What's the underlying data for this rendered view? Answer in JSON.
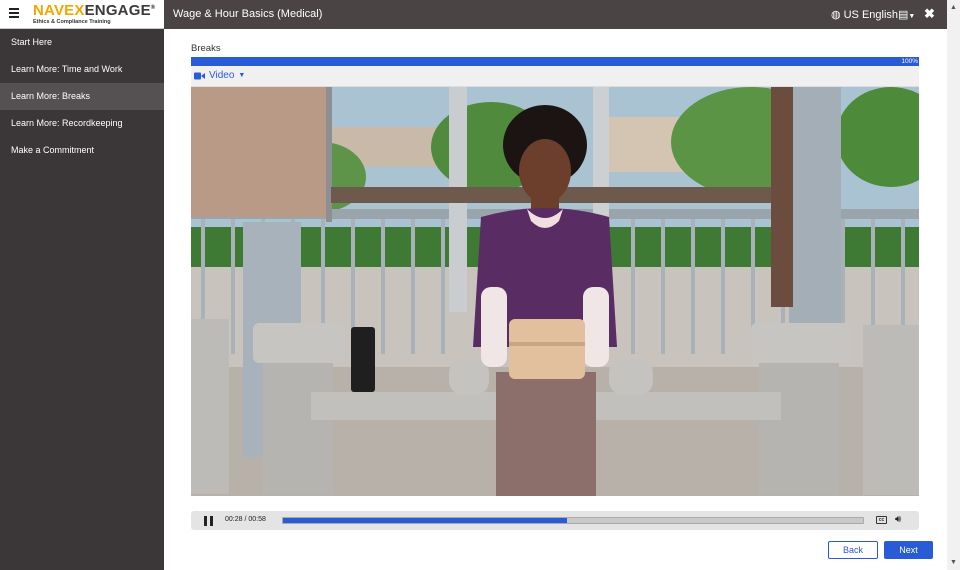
{
  "logo": {
    "brand_a": "NAVEX",
    "brand_b": "ENGAGE",
    "registered": "®",
    "tagline": "Ethics & Compliance Training"
  },
  "header": {
    "course_title": "Wage & Hour Basics (Medical)",
    "language": "US English"
  },
  "sidebar": {
    "items": [
      {
        "label": "Start Here",
        "active": false
      },
      {
        "label": "Learn More: Time and Work",
        "active": false
      },
      {
        "label": "Learn More: Breaks",
        "active": true
      },
      {
        "label": "Learn More: Recordkeeping",
        "active": false
      },
      {
        "label": "Make a Commitment",
        "active": false
      }
    ]
  },
  "main": {
    "section_title": "Breaks",
    "progress": {
      "percent_label": "100%",
      "value": 100
    },
    "video_tab_label": "Video",
    "player": {
      "time_display": "00:28 / 00:58",
      "played_fraction": 0.49
    }
  },
  "nav": {
    "back_label": "Back",
    "next_label": "Next"
  },
  "icons": [
    "hamburger-icon",
    "globe-icon",
    "document-icon",
    "caret-down-icon",
    "close-icon",
    "video-camera-icon",
    "pause-icon",
    "closed-captions-icon",
    "volume-icon"
  ],
  "colors": {
    "accent": "#2a5bd7",
    "topbar": "#4a4444",
    "sidebar": "#3b3637",
    "sidebar_active": "#555051",
    "logo_orange": "#f0a800"
  }
}
